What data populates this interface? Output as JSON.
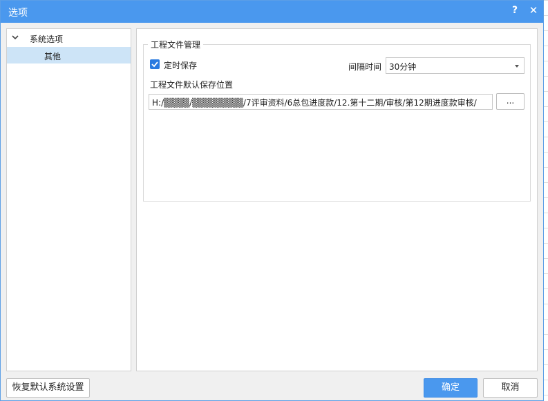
{
  "window": {
    "title": "选项",
    "help_label": "?",
    "close_label": "✕"
  },
  "tree": {
    "root": {
      "label": "系统选项",
      "expanded": true
    },
    "child": {
      "label": "其他",
      "selected": true
    }
  },
  "group": {
    "title": "工程文件管理",
    "autosave": {
      "label": "定时保存",
      "checked": true
    },
    "interval": {
      "label": "间隔时间",
      "value": "30分钟"
    },
    "path_label": "工程文件默认保存位置",
    "path_value": "H:/▒▒▒▒/▒▒▒▒▒▒▒▒/7评审资料/6总包进度款/12.第十二期/审核/第12期进度款审核/",
    "browse_label": "..."
  },
  "footer": {
    "reset_label": "恢复默认系统设置",
    "ok_label": "确定",
    "cancel_label": "取消"
  },
  "colors": {
    "titlebar": "#4a98ee",
    "selected_row": "#cde4f7",
    "primary_button": "#4a98ee",
    "checkbox": "#2b7be0"
  }
}
